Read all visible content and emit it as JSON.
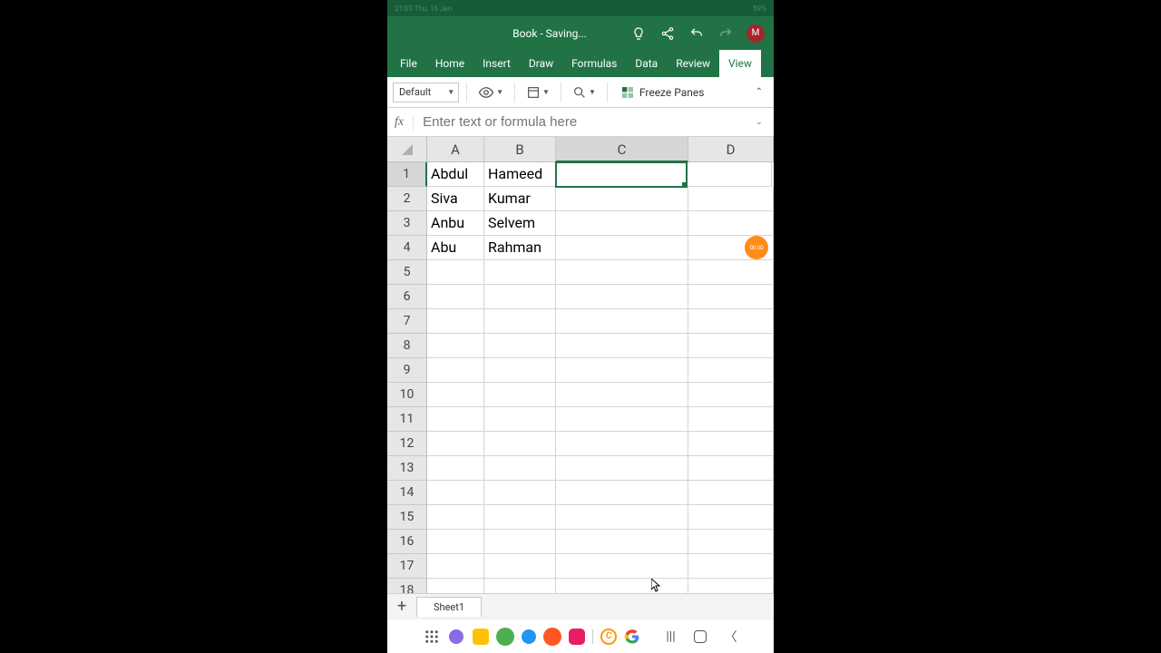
{
  "status": {
    "left": "21:03  Thu, 16 Jan",
    "right": "59%"
  },
  "titlebar": {
    "title": "Book - Saving...",
    "avatar": "M"
  },
  "ribbon": {
    "tabs": [
      "File",
      "Home",
      "Insert",
      "Draw",
      "Formulas",
      "Data",
      "Review",
      "View"
    ],
    "active": "View"
  },
  "toolbar": {
    "style": "Default",
    "freeze": "Freeze Panes"
  },
  "formula": {
    "fx": "fx",
    "placeholder": "Enter text or formula here"
  },
  "grid": {
    "columns": [
      "A",
      "B",
      "C",
      "D"
    ],
    "selected_cell": "C1",
    "rows": [
      {
        "num": 1,
        "A": "Abdul",
        "B": "Hameed"
      },
      {
        "num": 2,
        "A": "Siva",
        "B": "Kumar"
      },
      {
        "num": 3,
        "A": "Anbu",
        "B": "Selvem"
      },
      {
        "num": 4,
        "A": "Abu",
        "B": "Rahman"
      },
      {
        "num": 5
      },
      {
        "num": 6
      },
      {
        "num": 7
      },
      {
        "num": 8
      },
      {
        "num": 9
      },
      {
        "num": 10
      },
      {
        "num": 11
      },
      {
        "num": 12
      },
      {
        "num": 13
      },
      {
        "num": 14
      },
      {
        "num": 15
      },
      {
        "num": 16
      },
      {
        "num": 17
      },
      {
        "num": 18
      }
    ]
  },
  "sheets": {
    "active": "Sheet1"
  },
  "record": "00:00"
}
